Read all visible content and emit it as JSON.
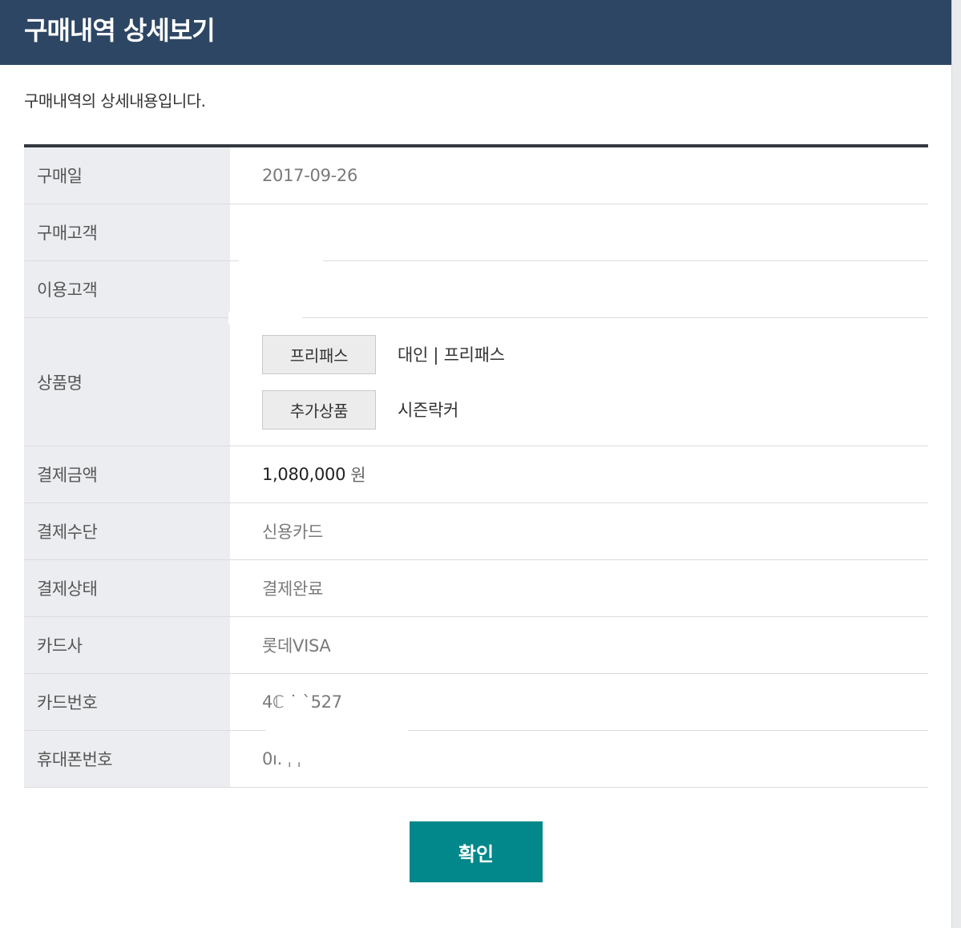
{
  "title": "구매내역 상세보기",
  "description": "구매내역의 상세내용입니다.",
  "rows": {
    "purchase_date": {
      "label": "구매일",
      "value": "2017-09-26"
    },
    "buyer": {
      "label": "구매고객",
      "value": ""
    },
    "user": {
      "label": "이용고객",
      "value": ""
    },
    "product": {
      "label": "상품명",
      "items": [
        {
          "tag": "프리패스",
          "name": "대인 | 프리패스"
        },
        {
          "tag": "추가상품",
          "name": "시즌락커"
        }
      ]
    },
    "amount": {
      "label": "결제금액",
      "value": "1,080,000",
      "unit": "원"
    },
    "method": {
      "label": "결제수단",
      "value": "신용카드"
    },
    "status": {
      "label": "결제상태",
      "value": "결제완료"
    },
    "card_company": {
      "label": "카드사",
      "value": "롯데VISA"
    },
    "card_number": {
      "label": "카드번호",
      "value": "4ℂ      ˙       ˋ527"
    },
    "phone": {
      "label": "휴대폰번호",
      "value": "0ı.         ˌ         ˌ"
    }
  },
  "confirm_label": "확인"
}
